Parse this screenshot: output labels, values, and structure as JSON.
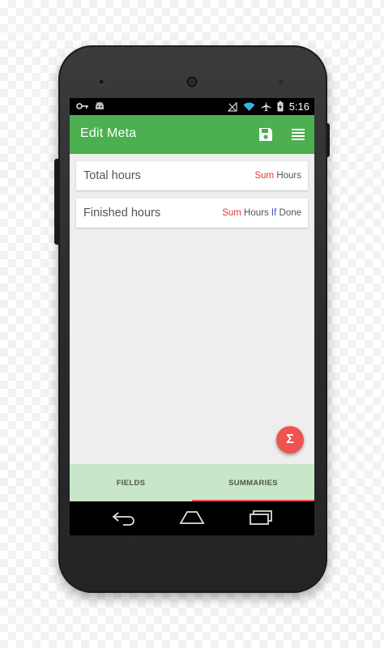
{
  "status_bar": {
    "time": "5:16",
    "left_icons": [
      "key-icon",
      "android-icon"
    ],
    "right_icons": [
      "signal-off-icon",
      "wifi-icon",
      "airplane-icon",
      "battery-charging-icon"
    ]
  },
  "app_bar": {
    "title": "Edit Meta",
    "save_icon": "save-icon",
    "menu_icon": "list-menu-icon",
    "color": "#4caf50"
  },
  "cards": [
    {
      "title": "Total hours",
      "formula": [
        {
          "text": "Sum",
          "kind": "keyword"
        },
        {
          "text": " Hours",
          "kind": "field"
        }
      ]
    },
    {
      "title": "Finished hours",
      "formula": [
        {
          "text": "Sum",
          "kind": "keyword"
        },
        {
          "text": " Hours ",
          "kind": "field"
        },
        {
          "text": "If",
          "kind": "keyword-dark"
        },
        {
          "text": " Done",
          "kind": "field"
        }
      ]
    }
  ],
  "fab": {
    "label": "Σ",
    "color": "#ef5350"
  },
  "tabs": [
    {
      "label": "FIELDS",
      "active": false
    },
    {
      "label": "SUMMARIES",
      "active": true
    }
  ],
  "nav": [
    "back-icon",
    "home-icon",
    "recents-icon"
  ]
}
